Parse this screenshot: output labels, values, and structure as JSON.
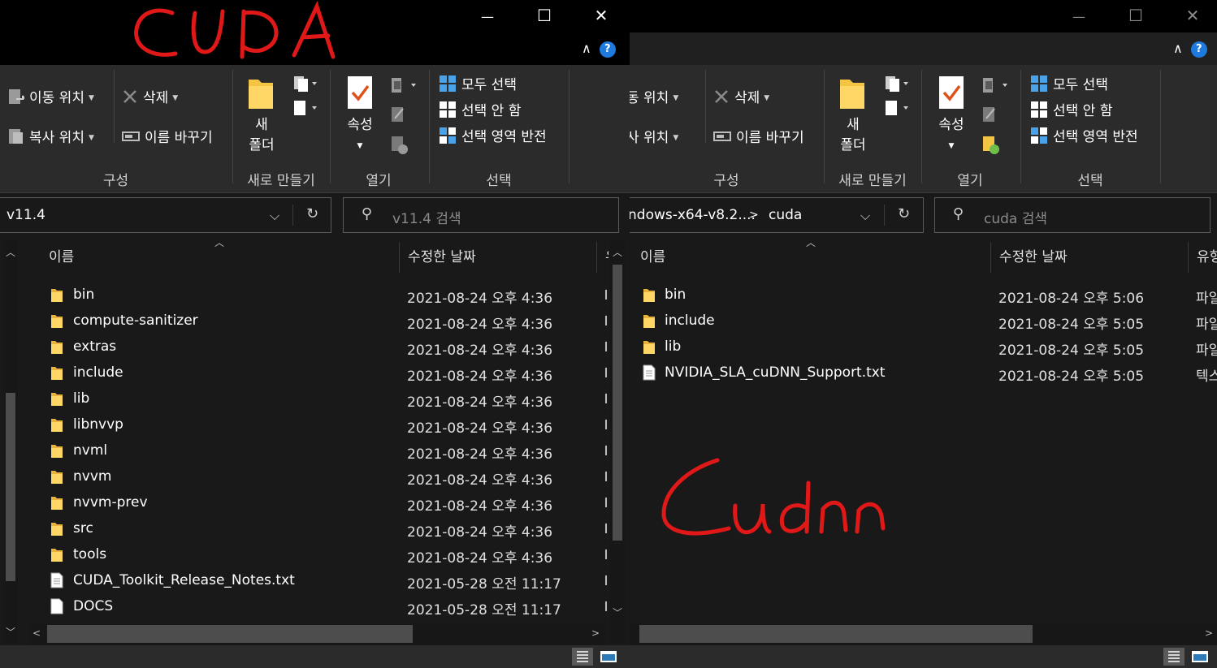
{
  "window_controls": {
    "minimize": "—",
    "maximize": "☐",
    "close": "✕",
    "collapse_ribbon": "∧",
    "help": "?"
  },
  "annotations": {
    "left": "CUDA",
    "right": "Cudnn",
    "color": "#e01818"
  },
  "ribbon": {
    "organize": {
      "move_to": "이동 위치",
      "copy_to": "복사 위치",
      "delete": "삭제",
      "rename": "이름 바꾸기",
      "group": "구성"
    },
    "new": {
      "new_folder_line1": "새",
      "new_folder_line2": "폴더",
      "group": "새로 만들기"
    },
    "open": {
      "properties": "속성",
      "group": "열기"
    },
    "select": {
      "select_all": "모두 선택",
      "select_none": "선택 안 함",
      "invert": "선택 영역 반전",
      "group": "선택"
    },
    "right_organize": {
      "move_to": "동 위치",
      "copy_to": "사 위치"
    }
  },
  "left": {
    "address": "v11.4",
    "search_placeholder": "v11.4 검색",
    "columns": {
      "name": "이름",
      "date": "수정한 날짜",
      "type": "유"
    },
    "rows": [
      {
        "name": "bin",
        "date": "2021-08-24 오후 4:36",
        "icon": "folder-icon"
      },
      {
        "name": "compute-sanitizer",
        "date": "2021-08-24 오후 4:36",
        "icon": "folder-icon"
      },
      {
        "name": "extras",
        "date": "2021-08-24 오후 4:36",
        "icon": "folder-icon"
      },
      {
        "name": "include",
        "date": "2021-08-24 오후 4:36",
        "icon": "folder-icon"
      },
      {
        "name": "lib",
        "date": "2021-08-24 오후 4:36",
        "icon": "folder-icon"
      },
      {
        "name": "libnvvp",
        "date": "2021-08-24 오후 4:36",
        "icon": "folder-icon"
      },
      {
        "name": "nvml",
        "date": "2021-08-24 오후 4:36",
        "icon": "folder-icon"
      },
      {
        "name": "nvvm",
        "date": "2021-08-24 오후 4:36",
        "icon": "folder-icon"
      },
      {
        "name": "nvvm-prev",
        "date": "2021-08-24 오후 4:36",
        "icon": "folder-icon"
      },
      {
        "name": "src",
        "date": "2021-08-24 오후 4:36",
        "icon": "folder-icon"
      },
      {
        "name": "tools",
        "date": "2021-08-24 오후 4:36",
        "icon": "folder-icon"
      },
      {
        "name": "CUDA_Toolkit_Release_Notes.txt",
        "date": "2021-05-28 오전 11:17",
        "icon": "text-file-icon"
      },
      {
        "name": "DOCS",
        "date": "2021-05-28 오전 11:17",
        "icon": "file-icon"
      }
    ]
  },
  "right": {
    "address_parent": "ndows-x64-v8.2....",
    "address_current": "cuda",
    "search_placeholder": "cuda 검색",
    "columns": {
      "name": "이름",
      "date": "수정한 날짜",
      "type": "유형"
    },
    "rows": [
      {
        "name": "bin",
        "date": "2021-08-24 오후 5:06",
        "type": "파일",
        "icon": "folder-icon"
      },
      {
        "name": "include",
        "date": "2021-08-24 오후 5:05",
        "type": "파일",
        "icon": "folder-icon"
      },
      {
        "name": "lib",
        "date": "2021-08-24 오후 5:05",
        "type": "파일",
        "icon": "folder-icon"
      },
      {
        "name": "NVIDIA_SLA_cuDNN_Support.txt",
        "date": "2021-08-24 오후 5:05",
        "type": "텍스",
        "icon": "text-file-icon"
      }
    ]
  }
}
